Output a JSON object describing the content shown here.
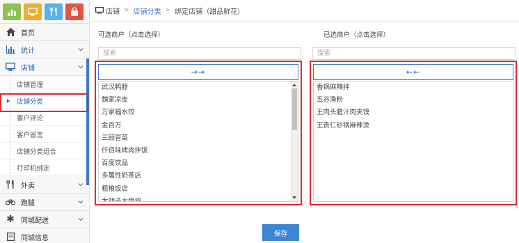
{
  "colors": {
    "brand": "#3b7cc4",
    "highlight": "#e0282e",
    "tile_green": "#8dc152",
    "tile_orange": "#f0ad32",
    "tile_blue": "#5ab1ea",
    "tile_red": "#e25444"
  },
  "sidebar": {
    "tiles": [
      {
        "icon": "bar-chart-icon"
      },
      {
        "icon": "monitor-icon"
      },
      {
        "icon": "fork-knife-icon"
      },
      {
        "icon": "shopping-bag-icon"
      }
    ],
    "items": [
      {
        "label": "首页",
        "icon": "home-icon"
      },
      {
        "label": "统计",
        "icon": "bar-chart-icon"
      },
      {
        "label": "店铺",
        "icon": "monitor-icon"
      }
    ],
    "store_sub": [
      {
        "label": "店铺管理"
      },
      {
        "label": "店铺分类"
      },
      {
        "label": "客户评论"
      },
      {
        "label": "客户留言"
      },
      {
        "label": "店铺分类组合"
      },
      {
        "label": "打印机绑定"
      }
    ],
    "items_after": [
      {
        "label": "外卖",
        "icon": "fork-knife-icon"
      },
      {
        "label": "跑腿",
        "icon": "bicycle-icon"
      },
      {
        "label": "同城配送",
        "icon": "asterisk-icon"
      },
      {
        "label": "同城信息",
        "icon": "document-icon"
      }
    ]
  },
  "breadcrumb": {
    "root": "店铺",
    "section": "店铺分类",
    "current": "绑定店铺（甜品鲜花）",
    "separator": ">"
  },
  "left_panel": {
    "title": "可选商户（点击选择）",
    "search_placeholder": "搜索",
    "move_label": "→→",
    "items": [
      "武汉鸭脖",
      "魏家凉皮",
      "万家福水饺",
      "金百万",
      "三顾冒菜",
      "仟佰味烤肉拌饭",
      "百度饮品",
      "多属性奶茶店",
      "粗粮饭店",
      "太胡子大盘鸡"
    ]
  },
  "right_panel": {
    "title": "已选商户（点击选择）",
    "search_placeholder": "搜索",
    "move_label": "←←",
    "items": [
      "香锅麻辣拌",
      "五谷渔粉",
      "王肉头腊汁肉夹馍",
      "王贵仁砂锅麻辣烫"
    ]
  },
  "save_label": "保存"
}
